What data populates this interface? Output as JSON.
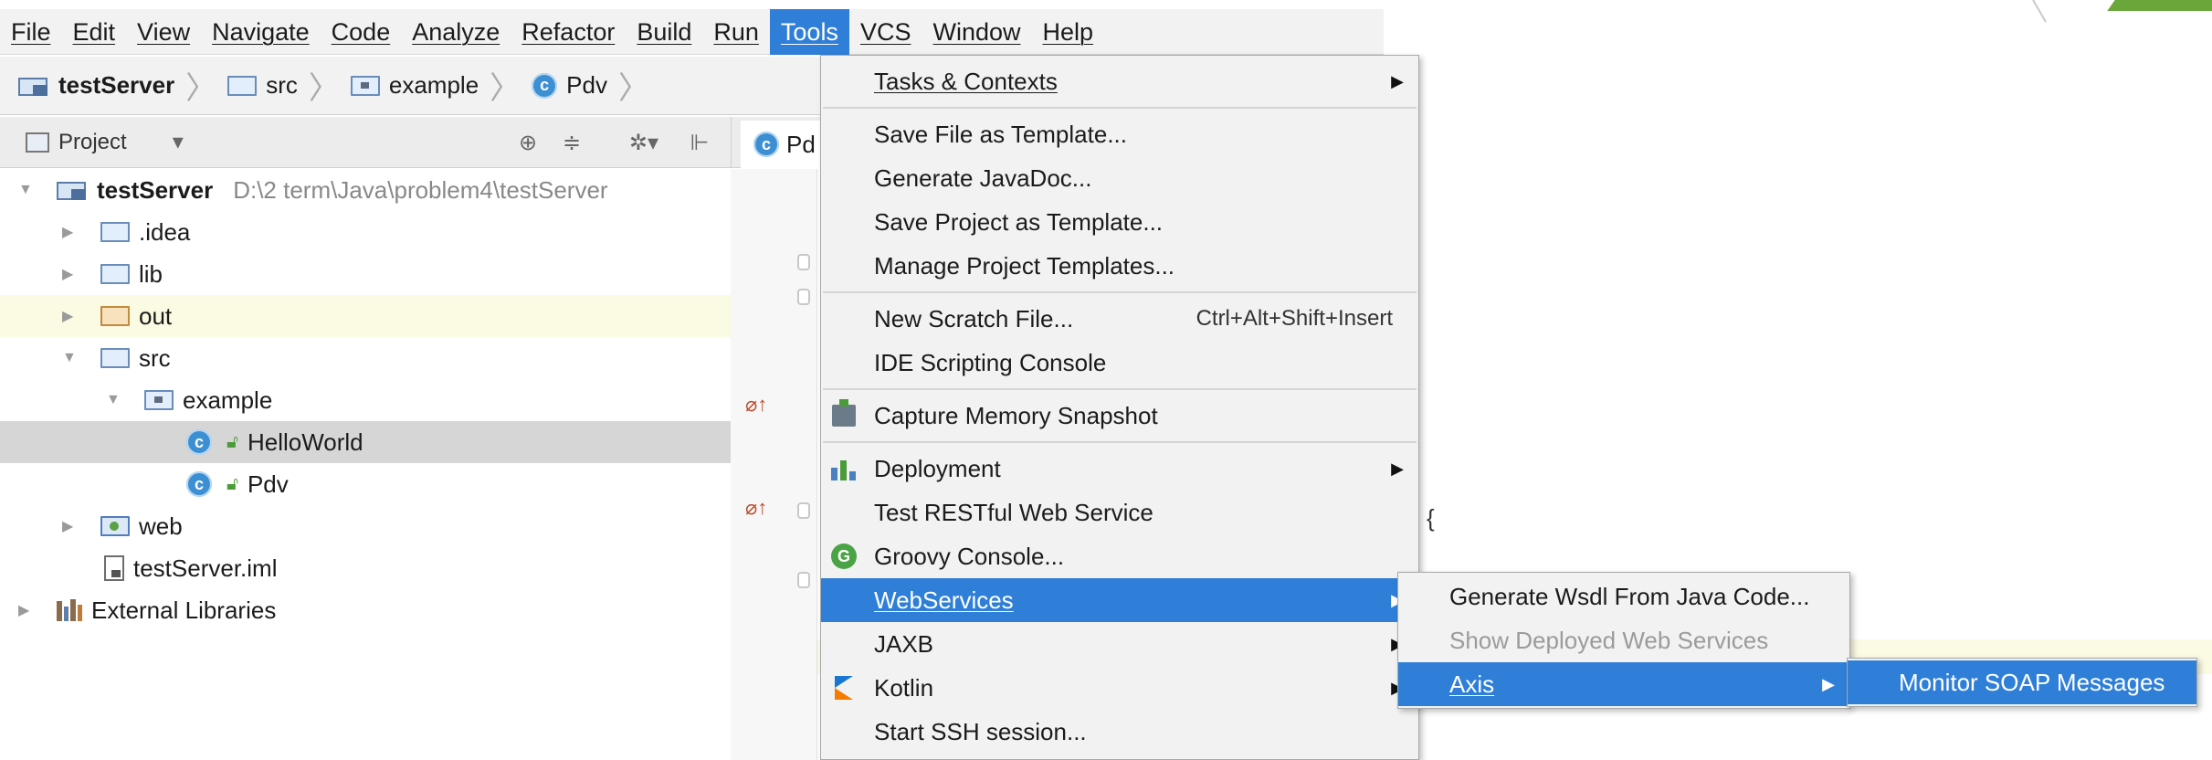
{
  "menubar": {
    "items": [
      "File",
      "Edit",
      "View",
      "Navigate",
      "Code",
      "Analyze",
      "Refactor",
      "Build",
      "Run",
      "Tools",
      "VCS",
      "Window",
      "Help"
    ],
    "active": "Tools"
  },
  "breadcrumb": {
    "items": [
      "testServer",
      "src",
      "example",
      "Pdv"
    ]
  },
  "project_panel": {
    "title": "Project",
    "dropdown_glyph": "▾",
    "tool_icons": [
      "⊕",
      "≑",
      "✲▾",
      "⊩"
    ]
  },
  "tree": {
    "root_name": "testServer",
    "root_path": "D:\\2 term\\Java\\problem4\\testServer",
    "idea": ".idea",
    "lib": "lib",
    "out": "out",
    "src": "src",
    "example": "example",
    "helloworld": "HelloWorld",
    "pdv": "Pdv",
    "web": "web",
    "iml": "testServer.iml",
    "external": "External Libraries"
  },
  "editor": {
    "tab_label": "Pd",
    "class_glyph": "c",
    "brace": "{"
  },
  "tools_menu": {
    "tasks": "Tasks & Contexts",
    "save_template": "Save File as Template...",
    "javadoc": "Generate JavaDoc...",
    "save_project_template": "Save Project as Template...",
    "manage_templates": "Manage Project Templates...",
    "scratch": "New Scratch File...",
    "scratch_shortcut": "Ctrl+Alt+Shift+Insert",
    "ide_console": "IDE Scripting Console",
    "capture_memory": "Capture Memory Snapshot",
    "deployment": "Deployment",
    "rest": "Test RESTful Web Service",
    "groovy": "Groovy Console...",
    "webservices": "WebServices",
    "jaxb": "JAXB",
    "kotlin": "Kotlin",
    "ssh": "Start SSH session..."
  },
  "webservices_menu": {
    "generate_wsdl": "Generate Wsdl From Java Code...",
    "show_deployed": "Show Deployed Web Services",
    "axis": "Axis"
  },
  "axis_menu": {
    "monitor_soap": "Monitor SOAP Messages"
  },
  "colors": {
    "menu_selection": "#2f7fd8",
    "menubar_bg": "#f2f2f2",
    "highlight_row": "#fbfae2",
    "selected_row": "#d6d6d6"
  }
}
